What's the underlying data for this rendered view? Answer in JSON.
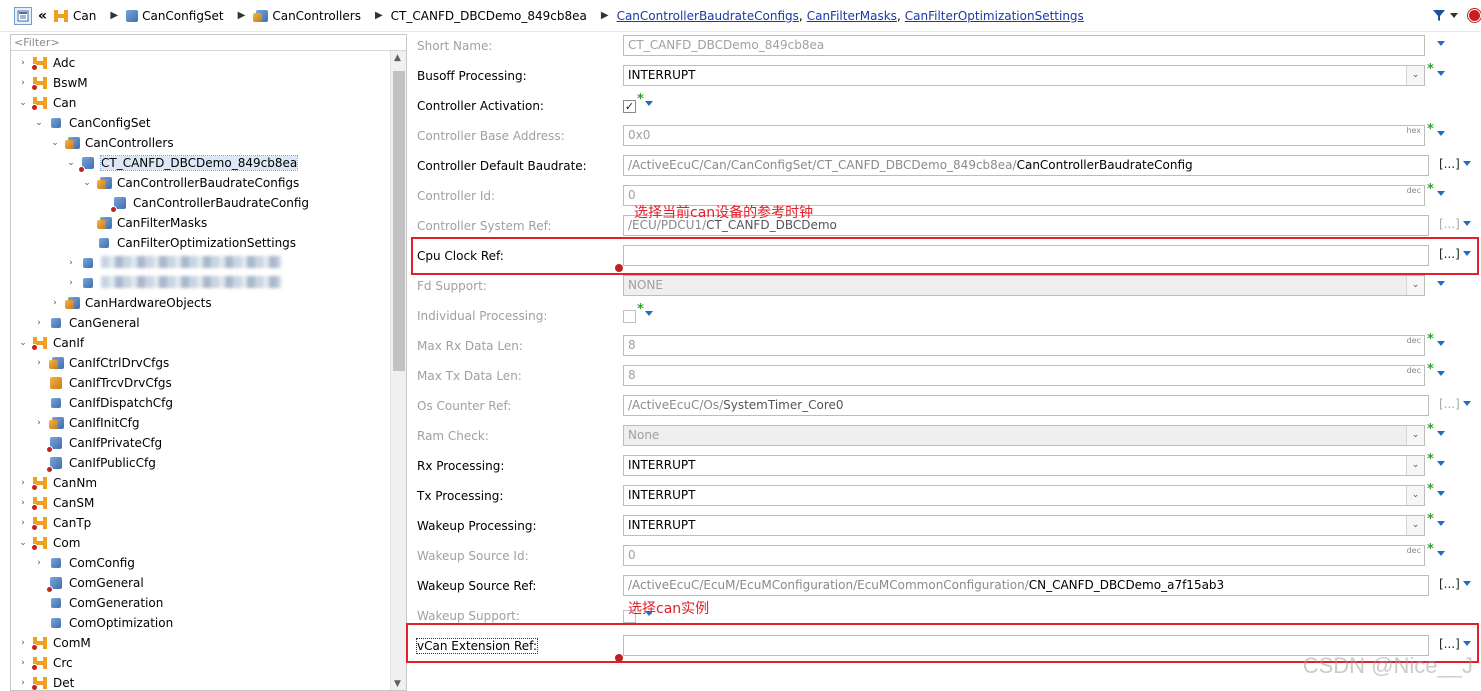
{
  "toolbar": {
    "breadcrumb": [
      "Can",
      "CanConfigSet",
      "CanControllers",
      "CT_CANFD_DBCDemo_849cb8ea"
    ],
    "links": [
      "CanControllerBaudrateConfigs",
      "CanFilterMasks",
      "CanFilterOptimizationSettings"
    ],
    "link_separator": ","
  },
  "tree": {
    "filter_placeholder": "<Filter>",
    "nodes": [
      {
        "label": "Adc",
        "level": 0,
        "toggle": "›",
        "icon": "module-icon"
      },
      {
        "label": "BswM",
        "level": 0,
        "toggle": "›",
        "icon": "module-icon"
      },
      {
        "label": "Can",
        "level": 0,
        "toggle": "⌄",
        "icon": "module-icon"
      },
      {
        "label": "CanConfigSet",
        "level": 1,
        "toggle": "⌄",
        "icon": "container-icon"
      },
      {
        "label": "CanControllers",
        "level": 2,
        "toggle": "⌄",
        "icon": "container-stack-icon"
      },
      {
        "label": "CT_CANFD_DBCDemo_849cb8ea",
        "level": 3,
        "toggle": "⌄",
        "icon": "container-error-icon",
        "selected": true
      },
      {
        "label": "CanControllerBaudrateConfigs",
        "level": 4,
        "toggle": "⌄",
        "icon": "container-stack-icon"
      },
      {
        "label": "CanControllerBaudrateConfig",
        "level": 5,
        "toggle": "",
        "icon": "container-error-icon"
      },
      {
        "label": "CanFilterMasks",
        "level": 4,
        "toggle": "",
        "icon": "container-stack-icon"
      },
      {
        "label": "CanFilterOptimizationSettings",
        "level": 4,
        "toggle": "",
        "icon": "container-icon"
      },
      {
        "label": "",
        "level": 3,
        "toggle": "›",
        "icon": "container-icon",
        "blurred": true
      },
      {
        "label": "",
        "level": 3,
        "toggle": "›",
        "icon": "container-icon",
        "blurred": true
      },
      {
        "label": "CanHardwareObjects",
        "level": 2,
        "toggle": "›",
        "icon": "container-stack-icon"
      },
      {
        "label": "CanGeneral",
        "level": 1,
        "toggle": "›",
        "icon": "container-icon"
      },
      {
        "label": "CanIf",
        "level": 0,
        "toggle": "⌄",
        "icon": "module-icon"
      },
      {
        "label": "CanIfCtrlDrvCfgs",
        "level": 1,
        "toggle": "›",
        "icon": "container-stack-icon"
      },
      {
        "label": "CanIfTrcvDrvCfgs",
        "level": 1,
        "toggle": "",
        "icon": "container-orange-icon"
      },
      {
        "label": "CanIfDispatchCfg",
        "level": 1,
        "toggle": "",
        "icon": "container-icon"
      },
      {
        "label": "CanIfInitCfg",
        "level": 1,
        "toggle": "›",
        "icon": "container-stack-icon"
      },
      {
        "label": "CanIfPrivateCfg",
        "level": 1,
        "toggle": "",
        "icon": "container-error-icon"
      },
      {
        "label": "CanIfPublicCfg",
        "level": 1,
        "toggle": "",
        "icon": "container-error-icon"
      },
      {
        "label": "CanNm",
        "level": 0,
        "toggle": "›",
        "icon": "module-icon"
      },
      {
        "label": "CanSM",
        "level": 0,
        "toggle": "›",
        "icon": "module-icon"
      },
      {
        "label": "CanTp",
        "level": 0,
        "toggle": "›",
        "icon": "module-icon"
      },
      {
        "label": "Com",
        "level": 0,
        "toggle": "⌄",
        "icon": "module-icon"
      },
      {
        "label": "ComConfig",
        "level": 1,
        "toggle": "›",
        "icon": "container-icon"
      },
      {
        "label": "ComGeneral",
        "level": 1,
        "toggle": "",
        "icon": "container-error-icon"
      },
      {
        "label": "ComGeneration",
        "level": 1,
        "toggle": "",
        "icon": "container-icon"
      },
      {
        "label": "ComOptimization",
        "level": 1,
        "toggle": "",
        "icon": "container-icon"
      },
      {
        "label": "ComM",
        "level": 0,
        "toggle": "›",
        "icon": "module-icon"
      },
      {
        "label": "Crc",
        "level": 0,
        "toggle": "›",
        "icon": "module-icon"
      },
      {
        "label": "Det",
        "level": 0,
        "toggle": "›",
        "icon": "module-icon"
      }
    ]
  },
  "form": {
    "rows": [
      {
        "key": "short-name",
        "label": "Short Name:",
        "kind": "text",
        "value": "CT_CANFD_DBCDemo_849cb8ea",
        "disabled": true
      },
      {
        "key": "busoff-processing",
        "label": "Busoff Processing:",
        "kind": "combo",
        "value": "INTERRUPT",
        "disabled": false,
        "star": true
      },
      {
        "key": "controller-activation",
        "label": "Controller Activation:",
        "kind": "check",
        "checked": "✓",
        "disabled": false,
        "star": true
      },
      {
        "key": "controller-base-address",
        "label": "Controller Base Address:",
        "kind": "num",
        "value": "0x0",
        "unit": "hex",
        "disabled": true,
        "star": true
      },
      {
        "key": "controller-default-baudrate",
        "label": "Controller Default Baudrate:",
        "kind": "ref",
        "prefix": "/ActiveEcuC/Can/CanConfigSet/CT_CANFD_DBCDemo_849cb8ea/",
        "value": "CanControllerBaudrateConfig",
        "disabled": false
      },
      {
        "key": "controller-id",
        "label": "Controller Id:",
        "kind": "num",
        "value": "0",
        "unit": "dec",
        "disabled": true,
        "star": true
      },
      {
        "key": "controller-system-ref",
        "label": "Controller System Ref:",
        "kind": "ref",
        "prefix": "/ECU/PDCU1/",
        "value": "CT_CANFD_DBCDemo",
        "disabled": true
      },
      {
        "key": "cpu-clock-ref",
        "label": "Cpu Clock Ref:",
        "kind": "ref",
        "prefix": "",
        "value": "",
        "disabled": false,
        "error": true
      },
      {
        "key": "fd-support",
        "label": "Fd Support:",
        "kind": "combo",
        "value": "NONE",
        "disabled": true,
        "grey": true
      },
      {
        "key": "individual-processing",
        "label": "Individual Processing:",
        "kind": "check",
        "checked": "",
        "disabled": true,
        "star": true
      },
      {
        "key": "max-rx-data-len",
        "label": "Max Rx Data Len:",
        "kind": "num",
        "value": "8",
        "unit": "dec",
        "disabled": true,
        "star": true
      },
      {
        "key": "max-tx-data-len",
        "label": "Max Tx Data Len:",
        "kind": "num",
        "value": "8",
        "unit": "dec",
        "disabled": true,
        "star": true
      },
      {
        "key": "os-counter-ref",
        "label": "Os Counter Ref:",
        "kind": "ref",
        "prefix": "/ActiveEcuC/Os/",
        "value": "SystemTimer_Core0",
        "disabled": true
      },
      {
        "key": "ram-check",
        "label": "Ram Check:",
        "kind": "combo",
        "value": "None",
        "disabled": true,
        "grey": true,
        "star": true
      },
      {
        "key": "rx-processing",
        "label": "Rx Processing:",
        "kind": "combo",
        "value": "INTERRUPT",
        "disabled": false,
        "star": true
      },
      {
        "key": "tx-processing",
        "label": "Tx Processing:",
        "kind": "combo",
        "value": "INTERRUPT",
        "disabled": false,
        "star": true
      },
      {
        "key": "wakeup-processing",
        "label": "Wakeup Processing:",
        "kind": "combo",
        "value": "INTERRUPT",
        "disabled": false,
        "star": true
      },
      {
        "key": "wakeup-source-id",
        "label": "Wakeup Source Id:",
        "kind": "num",
        "value": "0",
        "unit": "dec",
        "disabled": true,
        "star": true
      },
      {
        "key": "wakeup-source-ref",
        "label": "Wakeup Source Ref:",
        "kind": "ref",
        "prefix": "/ActiveEcuC/EcuM/EcuMConfiguration/EcuMCommonConfiguration/",
        "value": "CN_CANFD_DBCDemo_a7f15ab3",
        "disabled": false
      },
      {
        "key": "wakeup-support",
        "label": "Wakeup Support:",
        "kind": "check",
        "checked": "",
        "disabled": true,
        "star": false
      },
      {
        "key": "vcan-extension-ref",
        "label": "vCan Extension Ref:",
        "kind": "ref",
        "prefix": "",
        "value": "",
        "disabled": false,
        "error": true
      }
    ],
    "ellipsis": "[...]",
    "star": "*"
  },
  "annotations": {
    "cpu_clock_note": "选择当前can设备的参考时钟",
    "vcan_note": "选择can实例",
    "color": "#e0202a"
  },
  "watermark": "CSDN @Nice__J"
}
